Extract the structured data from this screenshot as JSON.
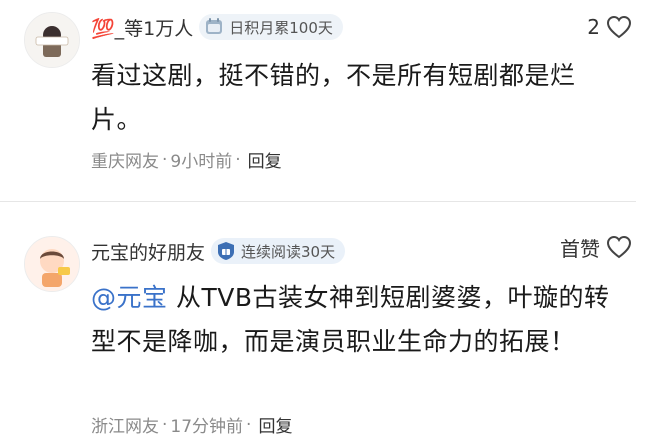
{
  "comments": [
    {
      "username": "💯_等1万人",
      "badge": "日积月累100天",
      "likes": "2",
      "text": "看过这剧，挺不错的，不是所有短剧都是烂片。",
      "location": "重庆网友",
      "time": "9小时前",
      "reply_label": "回复",
      "badge_color": "#eef3f8"
    },
    {
      "username": "元宝的好朋友",
      "badge": "连续阅读30天",
      "like_label": "首赞",
      "mention": "@元宝",
      "text": " 从TVB古装女神到短剧婆婆，叶璇的转型不是降咖，而是演员职业生命力的拓展！",
      "location": "浙江网友",
      "time": "17分钟前",
      "reply_label": "回复",
      "mention_color": "#3a72c9"
    }
  ],
  "separator": "·"
}
